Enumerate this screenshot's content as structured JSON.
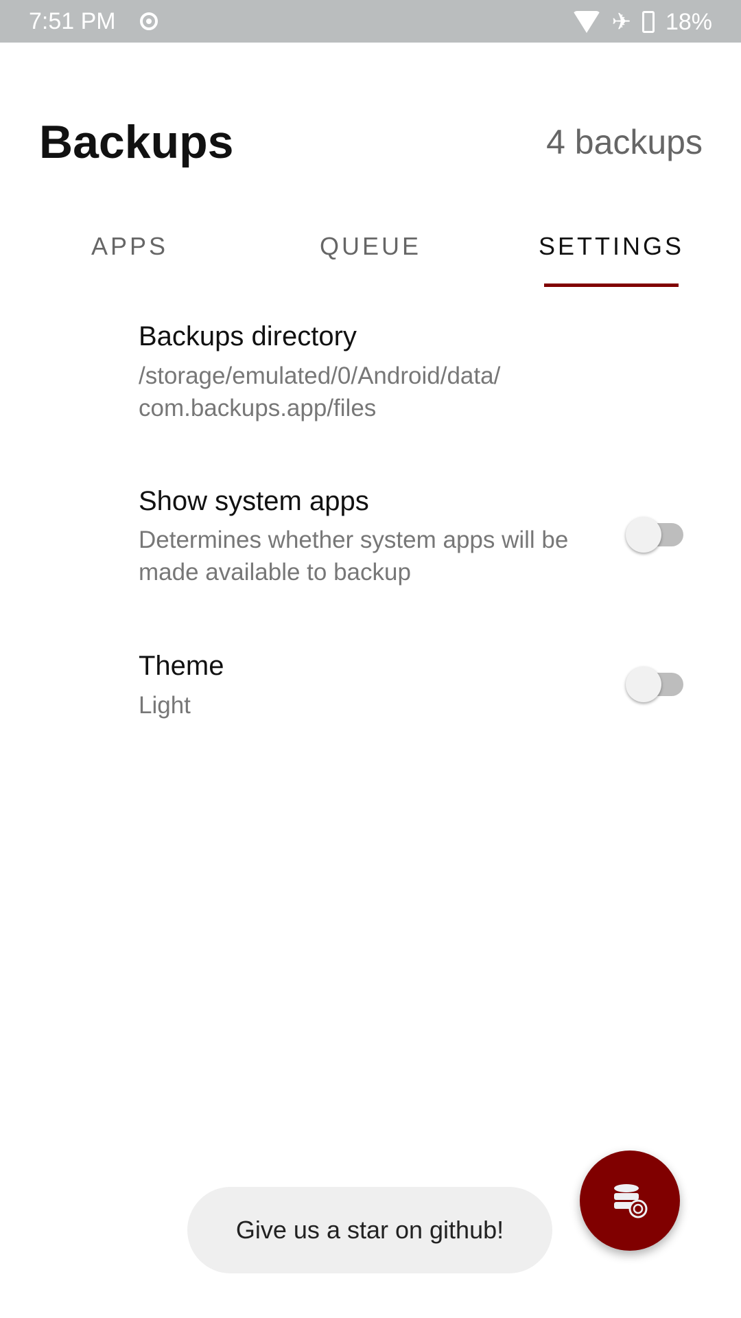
{
  "status_bar": {
    "time": "7:51 PM",
    "battery": "18%"
  },
  "header": {
    "title": "Backups",
    "count": "4 backups"
  },
  "tabs": [
    {
      "label": "APPS"
    },
    {
      "label": "QUEUE"
    },
    {
      "label": "SETTINGS",
      "active": true
    }
  ],
  "settings": [
    {
      "title": "Backups directory",
      "subtitle": "/storage/emulated/0/Android/data/ com.backups.app/files"
    },
    {
      "title": "Show system apps",
      "subtitle": "Determines whether system apps will be made available to backup",
      "toggle": false
    },
    {
      "title": "Theme",
      "subtitle": "Light",
      "toggle": false
    }
  ],
  "toast": {
    "text": "Give us a star on github!"
  },
  "fab": {
    "icon": "database-sync-icon"
  },
  "colors": {
    "accent": "#800000",
    "status_bar": "#babdbe"
  }
}
